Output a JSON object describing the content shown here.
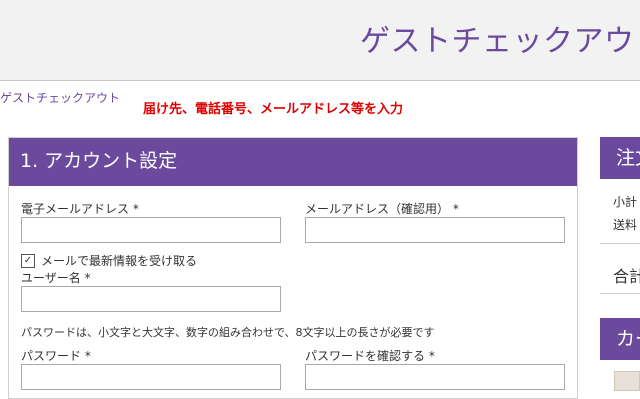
{
  "header": {
    "title": "ゲストチェックアウト"
  },
  "breadcrumb": "ゲストチェックアウト",
  "annotation": "届け先、電話番号、メールアドレス等を入力",
  "account": {
    "title": "1. アカウント設定",
    "email_label": "電子メールアドレス *",
    "email_confirm_label": "メールアドレス（確認用） *",
    "newsletter_label": "メールで最新情報を受け取る",
    "newsletter_checked": true,
    "username_label": "ユーザー名 *",
    "password_hint": "パスワードは、小文字と大文字、数字の組み合わせで、8文字以上の長さが必要です",
    "password_label": "パスワード *",
    "password_confirm_label": "パスワードを確認する *"
  },
  "order": {
    "title": "注文",
    "subtotal_label": "小計",
    "shipping_label": "送料",
    "total_label": "合計"
  },
  "cart": {
    "title": "カー"
  }
}
